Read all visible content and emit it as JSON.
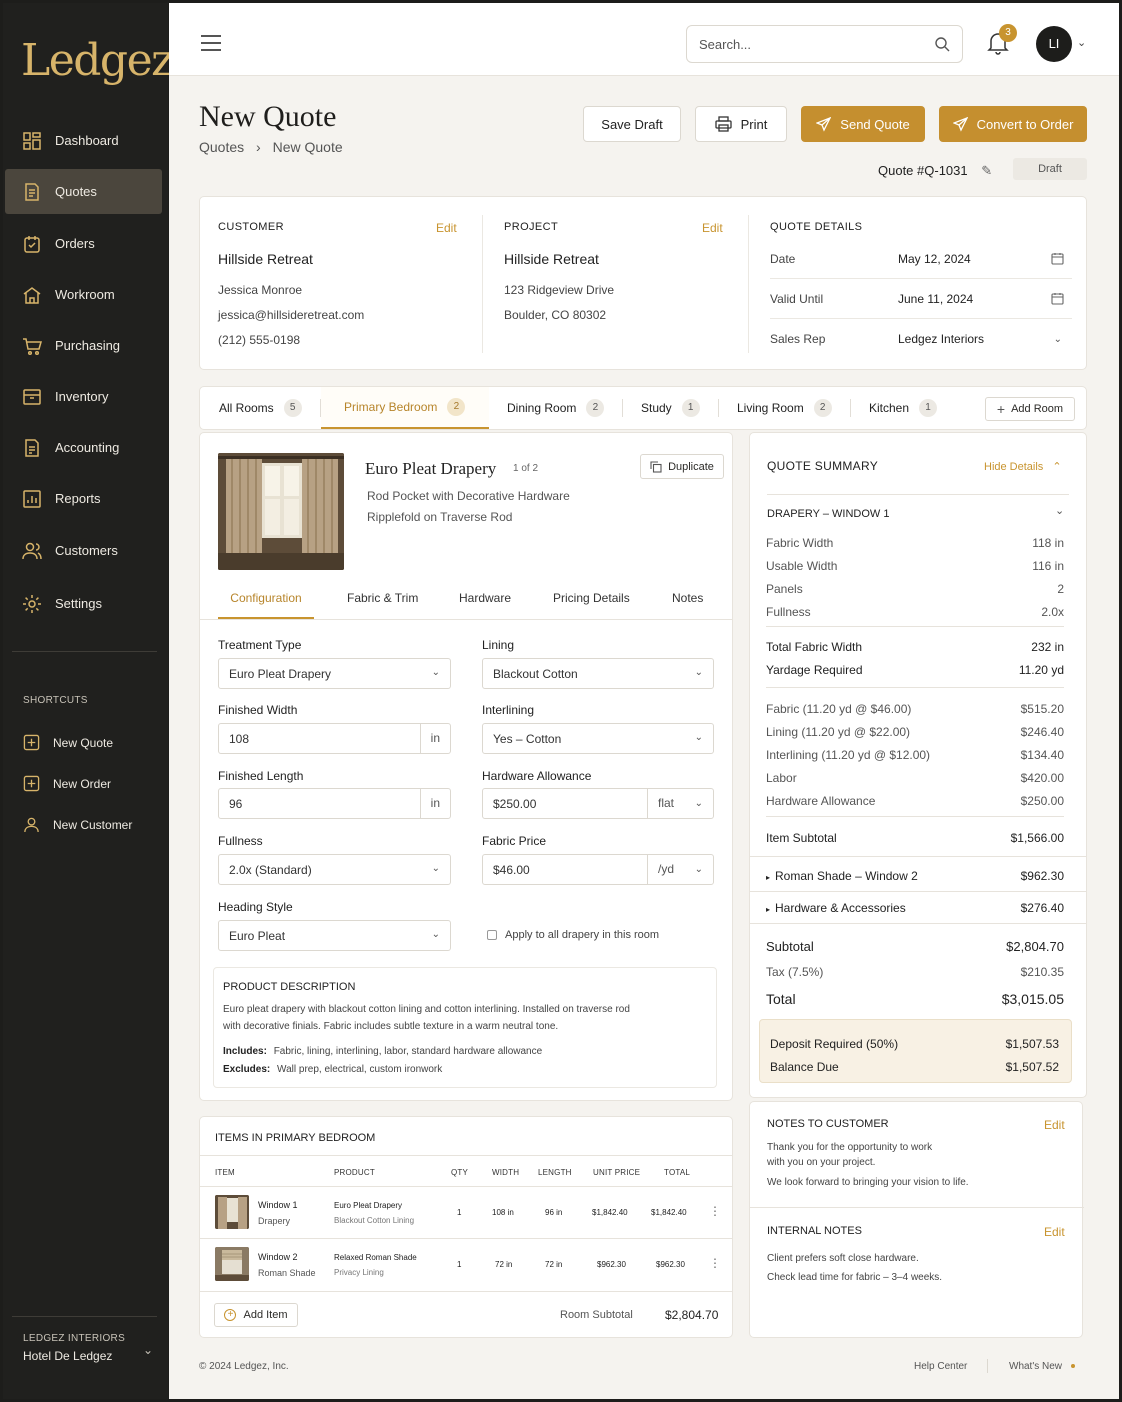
{
  "app": {
    "logo": "Ledgez"
  },
  "sidebar": {
    "items": [
      {
        "label": "Dashboard",
        "icon": "dashboard-icon"
      },
      {
        "label": "Quotes",
        "icon": "quote-doc-icon",
        "active": true
      },
      {
        "label": "Orders",
        "icon": "orders-icon"
      },
      {
        "label": "Workroom",
        "icon": "workroom-icon"
      },
      {
        "label": "Purchasing",
        "icon": "cart-icon"
      },
      {
        "label": "Inventory",
        "icon": "inventory-icon"
      },
      {
        "label": "Accounting",
        "icon": "accounting-icon"
      },
      {
        "label": "Reports",
        "icon": "reports-icon"
      },
      {
        "label": "Customers",
        "icon": "customers-icon"
      },
      {
        "label": "Settings",
        "icon": "gear-icon"
      }
    ],
    "shortcuts_title": "SHORTCUTS",
    "shortcuts": [
      {
        "label": "New Quote",
        "icon": "plus-square-icon"
      },
      {
        "label": "New Order",
        "icon": "plus-square-icon"
      },
      {
        "label": "New Customer",
        "icon": "user-icon"
      }
    ],
    "org_label": "LEDGEZ INTERIORS",
    "org_name": "Hotel De Ledgez"
  },
  "topbar": {
    "search_placeholder": "Search...",
    "notifications": "3",
    "avatar_initials": "LI"
  },
  "page": {
    "title": "New Quote",
    "breadcrumb": [
      "Quotes",
      "New Quote"
    ],
    "buttons": {
      "save_draft": "Save Draft",
      "print": "Print",
      "send_quote": "Send Quote",
      "convert": "Convert to Order"
    },
    "quote_number": "Quote #Q-1031",
    "status": "Draft"
  },
  "customer": {
    "label": "CUSTOMER",
    "edit": "Edit",
    "name": "Hillside Retreat",
    "contact": "Jessica Monroe",
    "email": "jessica@hillsideretreat.com",
    "phone": "(212) 555-0198"
  },
  "project": {
    "label": "PROJECT",
    "edit": "Edit",
    "name": "Hillside Retreat",
    "address1": "123 Ridgeview Drive",
    "address2": "Boulder, CO 80302"
  },
  "quote_details": {
    "label": "QUOTE DETAILS",
    "rows": [
      {
        "label": "Date",
        "value": "May 12, 2024"
      },
      {
        "label": "Valid Until",
        "value": "June 11, 2024"
      },
      {
        "label": "Sales Rep",
        "value": "Ledgez Interiors"
      }
    ]
  },
  "rooms": {
    "tabs": [
      {
        "label": "All Rooms",
        "count": "5"
      },
      {
        "label": "Primary Bedroom",
        "count": "2",
        "active": true
      },
      {
        "label": "Dining Room",
        "count": "2"
      },
      {
        "label": "Study",
        "count": "1"
      },
      {
        "label": "Living Room",
        "count": "2"
      },
      {
        "label": "Kitchen",
        "count": "1"
      }
    ],
    "add_room": "Add Room"
  },
  "item": {
    "title": "Euro Pleat Drapery",
    "position": "1 of 2",
    "duplicate": "Duplicate",
    "line1": "Rod Pocket with Decorative Hardware",
    "line2": "Ripplefold on Traverse Rod",
    "tabs": [
      "Configuration",
      "Fabric & Trim",
      "Hardware",
      "Pricing Details",
      "Notes"
    ]
  },
  "config": {
    "treatment_type": {
      "label": "Treatment Type",
      "value": "Euro Pleat Drapery"
    },
    "lining": {
      "label": "Lining",
      "value": "Blackout Cotton"
    },
    "finished_width": {
      "label": "Finished Width",
      "value": "108",
      "unit": "in"
    },
    "interlining": {
      "label": "Interlining",
      "value": "Yes – Cotton"
    },
    "finished_length": {
      "label": "Finished Length",
      "value": "96",
      "unit": "in"
    },
    "hardware_allowance": {
      "label": "Hardware Allowance",
      "value": "$250.00",
      "unit": "flat"
    },
    "fullness": {
      "label": "Fullness",
      "value": "2.0x (Standard)"
    },
    "fabric_price": {
      "label": "Fabric Price",
      "value": "$46.00",
      "unit": "/yd"
    },
    "heading_style": {
      "label": "Heading Style",
      "value": "Euro Pleat"
    },
    "apply_all": "Apply to all drapery in this room"
  },
  "description": {
    "title": "PRODUCT DESCRIPTION",
    "line1": "Euro pleat drapery with blackout cotton lining and cotton interlining. Installed on traverse rod",
    "line2": "with decorative finials. Fabric includes subtle texture in a warm neutral tone.",
    "includes_label": "Includes:",
    "includes": "Fabric, lining, interlining, labor, standard hardware allowance",
    "excludes_label": "Excludes:",
    "excludes": "Wall prep, electrical, custom ironwork"
  },
  "items_table": {
    "title": "ITEMS IN PRIMARY BEDROOM",
    "headers": [
      "ITEM",
      "PRODUCT",
      "QTY",
      "WIDTH",
      "LENGTH",
      "UNIT PRICE",
      "TOTAL"
    ],
    "rows": [
      {
        "item": "Window 1",
        "item_sub": "Drapery",
        "product": "Euro Pleat Drapery",
        "product_sub": "Blackout Cotton Lining",
        "qty": "1",
        "width": "108 in",
        "length": "96 in",
        "unit": "$1,842.40",
        "total": "$1,842.40"
      },
      {
        "item": "Window 2",
        "item_sub": "Roman Shade",
        "product": "Relaxed Roman Shade",
        "product_sub": "Privacy Lining",
        "qty": "1",
        "width": "72 in",
        "length": "72 in",
        "unit": "$962.30",
        "total": "$962.30"
      }
    ],
    "add_item": "Add Item",
    "subtotal_label": "Room Subtotal",
    "subtotal": "$2,804.70"
  },
  "summary": {
    "title": "QUOTE SUMMARY",
    "hide": "Hide Details",
    "section": "DRAPERY – WINDOW 1",
    "rows1": [
      {
        "label": "Fabric Width",
        "value": "118 in"
      },
      {
        "label": "Usable Width",
        "value": "116 in"
      },
      {
        "label": "Panels",
        "value": "2"
      },
      {
        "label": "Fullness",
        "value": "2.0x"
      }
    ],
    "total_fabric_width": {
      "label": "Total Fabric Width",
      "value": "232 in"
    },
    "yardage": {
      "label": "Yardage Required",
      "value": "11.20 yd"
    },
    "rows2": [
      {
        "label": "Fabric (11.20 yd @ $46.00)",
        "value": "$515.20"
      },
      {
        "label": "Lining (11.20 yd @ $22.00)",
        "value": "$246.40"
      },
      {
        "label": "Interlining (11.20 yd @ $12.00)",
        "value": "$134.40"
      },
      {
        "label": "Labor",
        "value": "$420.00"
      },
      {
        "label": "Hardware Allowance",
        "value": "$250.00"
      }
    ],
    "item_subtotal": {
      "label": "Item Subtotal",
      "value": "$1,566.00"
    },
    "roman": {
      "label": "Roman Shade – Window 2",
      "value": "$962.30"
    },
    "hardware": {
      "label": "Hardware & Accessories",
      "value": "$276.40"
    },
    "subtotal": {
      "label": "Subtotal",
      "value": "$2,804.70"
    },
    "tax": {
      "label": "Tax (7.5%)",
      "value": "$210.35"
    },
    "total": {
      "label": "Total",
      "value": "$3,015.05"
    },
    "deposit": {
      "label": "Deposit Required (50%)",
      "value": "$1,507.53"
    },
    "balance": {
      "label": "Balance Due",
      "value": "$1,507.52"
    }
  },
  "notes": {
    "customer_title": "NOTES TO CUSTOMER",
    "edit": "Edit",
    "customer_line1": "Thank you for the opportunity to work",
    "customer_line2": "with you on your project.",
    "customer_line3": "We look forward to bringing your vision to life.",
    "internal_title": "INTERNAL NOTES",
    "internal_line1": "Client prefers soft close hardware.",
    "internal_line2": "Check lead time for fabric – 3–4 weeks."
  },
  "footer": {
    "copyright": "© 2024 Ledgez, Inc.",
    "help": "Help Center",
    "whats_new": "What's New"
  },
  "colors": {
    "accent": "#c58f2f",
    "sidebar": "#20201e",
    "background": "#f5f3ef"
  }
}
